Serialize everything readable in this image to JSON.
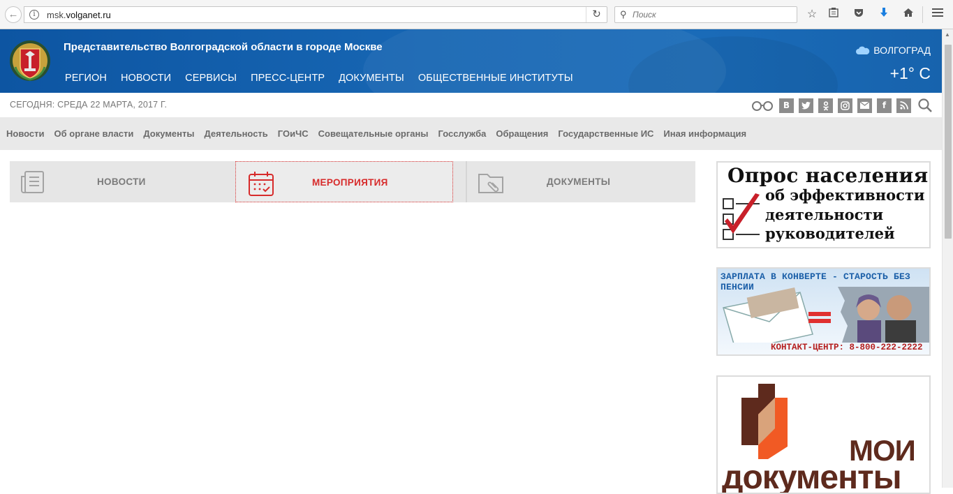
{
  "browser": {
    "url_prefix": "msk.",
    "url_domain": "volganet.ru",
    "search_placeholder": "Поиск"
  },
  "header": {
    "site_title": "Представительство Волгоградской области в городе Москве",
    "nav": [
      "РЕГИОН",
      "НОВОСТИ",
      "СЕРВИСЫ",
      "ПРЕСС-ЦЕНТР",
      "ДОКУМЕНТЫ",
      "ОБЩЕСТВЕННЫЕ ИНСТИТУТЫ"
    ],
    "weather_city": "ВОЛГОГРАД",
    "weather_temp": "+1° C"
  },
  "datebar": {
    "date": "СЕГОДНЯ: СРЕДА 22 МАРТА, 2017 Г.",
    "socials": [
      "В",
      "t",
      "ок",
      "ig",
      "✉",
      "f",
      "rss"
    ]
  },
  "subnav": [
    "Новости",
    "Об органе власти",
    "Документы",
    "Деятельность",
    "ГОиЧС",
    "Совещательные органы",
    "Госслужба",
    "Обращения",
    "Государственные ИС",
    "Иная информация"
  ],
  "tabs": [
    {
      "label": "НОВОСТИ",
      "active": false
    },
    {
      "label": "МЕРОПРИЯТИЯ",
      "active": true
    },
    {
      "label": "ДОКУМЕНТЫ",
      "active": false
    }
  ],
  "banners": {
    "survey": {
      "line1": "Опрос населения",
      "line2": "об эффективности",
      "line3": "деятельности",
      "line4": "руководителей"
    },
    "salary": {
      "top": "ЗАРПЛАТА В КОНВЕРТЕ - СТАРОСТЬ БЕЗ ПЕНСИИ",
      "bottom": "КОНТАКТ-ЦЕНТР: 8-800-222-2222"
    },
    "mfc": {
      "word1": "МОИ",
      "word2": "документы"
    }
  },
  "colors": {
    "header_blue": "#1766b3",
    "accent_red": "#d72b2b",
    "tab_gray": "#e6e6e6"
  }
}
